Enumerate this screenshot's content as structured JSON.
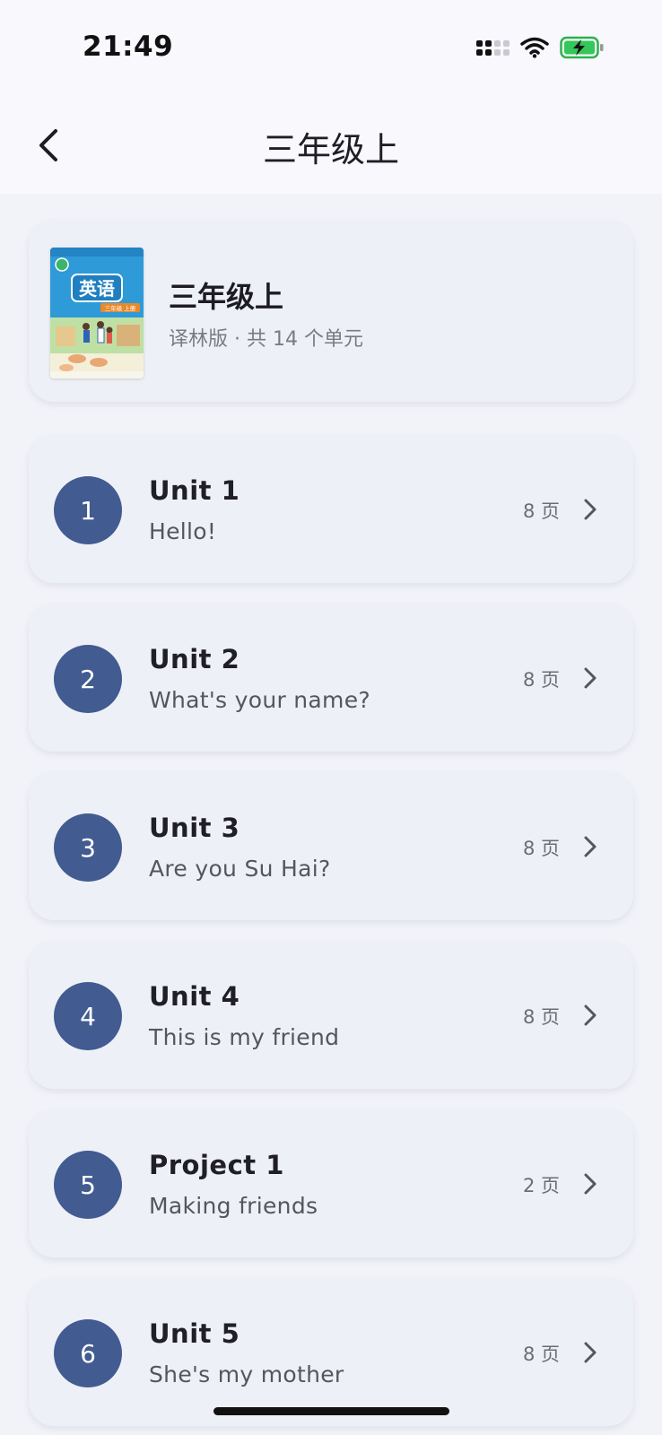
{
  "status": {
    "time": "21:49"
  },
  "nav": {
    "title": "三年级上"
  },
  "book": {
    "title": "三年级上",
    "subtitle": "译林版 · 共 14 个单元",
    "cover_text": "英语",
    "cover_tag": "三年级 上册"
  },
  "units": [
    {
      "index": "1",
      "name": "Unit 1",
      "subtitle": "Hello!",
      "pages": "8 页"
    },
    {
      "index": "2",
      "name": "Unit 2",
      "subtitle": "What's your name?",
      "pages": "8 页"
    },
    {
      "index": "3",
      "name": "Unit 3",
      "subtitle": "Are you Su Hai?",
      "pages": "8 页"
    },
    {
      "index": "4",
      "name": "Unit 4",
      "subtitle": "This is my friend",
      "pages": "8 页"
    },
    {
      "index": "5",
      "name": "Project 1",
      "subtitle": "Making friends",
      "pages": "2 页"
    },
    {
      "index": "6",
      "name": "Unit 5",
      "subtitle": "She's my mother",
      "pages": "8 页"
    }
  ],
  "colors": {
    "accent": "#425b90",
    "background": "#f2f3f8",
    "card": "#eef0f7",
    "battery": "#34c759"
  },
  "icons": {
    "back": "chevron-left-icon",
    "row": "chevron-right-icon",
    "wifi": "wifi-icon",
    "battery": "battery-charging-icon",
    "signal": "cellular-signal-icon"
  }
}
